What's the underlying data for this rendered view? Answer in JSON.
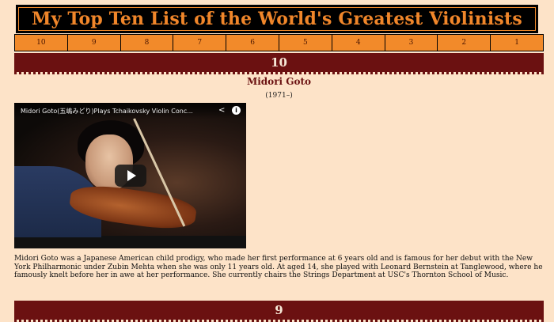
{
  "header": {
    "title": "My Top Ten List of the World's Greatest Violinists"
  },
  "nav": {
    "items": [
      "10",
      "9",
      "8",
      "7",
      "6",
      "5",
      "4",
      "3",
      "2",
      "1"
    ]
  },
  "entries": [
    {
      "rank": "10",
      "name": "Midori Goto",
      "years": "(1971–)",
      "video": {
        "title": "Midori Goto(五嶋みどり)Plays Tchaikovsky Violin Conc..."
      },
      "description": "Midori Goto was a Japanese American child prodigy, who made her first performance at 6 years old and is famous for her debut with the New York Philharmonic under Zubin Mehta when she was only 11 years old. At aged 14, she played with Leonard Bernstein at Tanglewood, where he famously knelt before her in awe at her performance. She currently chairs the Strings Department at USC's Thornton School of Music."
    },
    {
      "rank": "9"
    }
  ],
  "colors": {
    "background": "#fde3c8",
    "accent_orange": "#f28a2a",
    "header_maroon": "#6b1111",
    "title_bar": "#000000"
  },
  "icons": [
    "share-icon",
    "info-icon",
    "play-icon"
  ]
}
